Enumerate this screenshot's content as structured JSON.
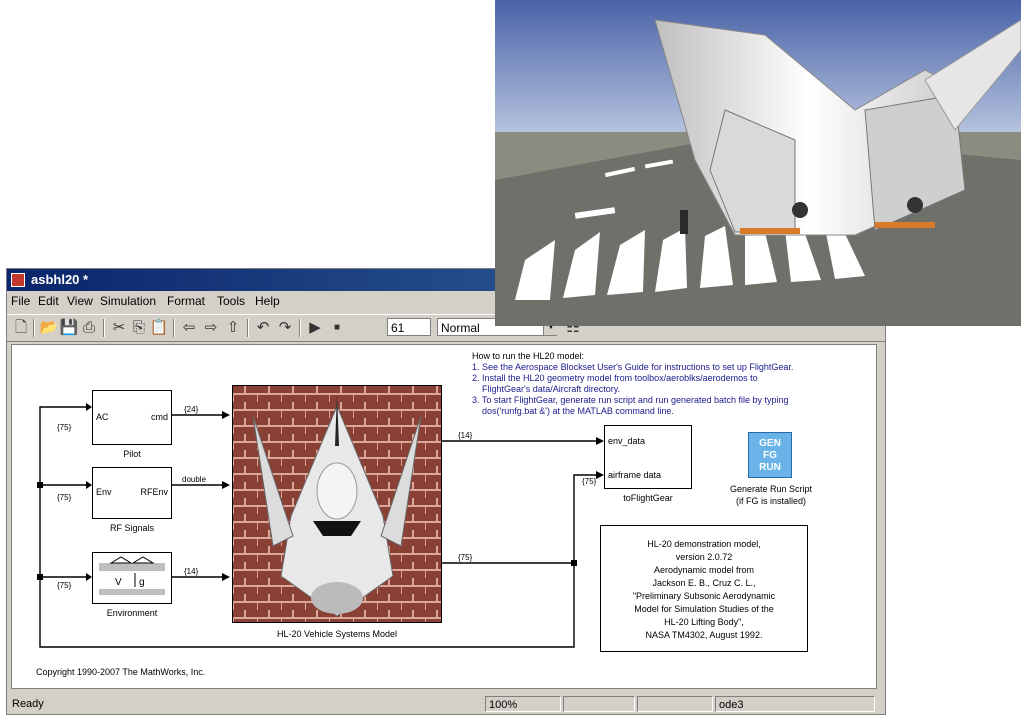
{
  "window": {
    "title": "asbhl20 *",
    "menu": [
      "File",
      "Edit",
      "View",
      "Simulation",
      "Format",
      "Tools",
      "Help"
    ],
    "stop_time": "61",
    "sim_mode": "Normal"
  },
  "blocks": {
    "pilot": {
      "label": "Pilot",
      "in_port": "AC",
      "out_port": "cmd"
    },
    "rf": {
      "label": "RF Signals",
      "in_port": "Env",
      "out_port": "RFEnv"
    },
    "env": {
      "label": "Environment"
    },
    "vehicle": {
      "label": "HL-20 Vehicle Systems Model"
    },
    "tofg": {
      "label": "toFlightGear",
      "in_port_1": "env_data",
      "in_port_2": "airframe data"
    },
    "gen": {
      "btn_l1": "GEN",
      "btn_l2": "FG",
      "btn_l3": "RUN",
      "label_l1": "Generate Run Script",
      "label_l2": "(if FG is installed)"
    }
  },
  "signals": {
    "pilot_out": "{24}",
    "rf_out": "double",
    "env_out": "{14}",
    "pilot_in": "{75}",
    "rf_in": "{75}",
    "env_in": "{75}",
    "vehicle_env": "{14}",
    "vehicle_airframe": "{75}",
    "tofg_in2": "{75}"
  },
  "howto": [
    "How to run the HL20 model:",
    "1. See the Aerospace Blockset User's Guide for instructions to set up FlightGear.",
    "2. Install the HL20 geometry model from toolbox/aeroblks/aerodemos to",
    "    FlightGear's data/Aircraft directory.",
    "3. To start FlightGear, generate run script and run generated batch file by typing",
    "    dos('runfg.bat &') at the MATLAB command line."
  ],
  "notes": [
    "HL-20 demonstration model,",
    "version 2.0.72",
    "Aerodynamic model from",
    "Jackson E. B., Cruz C. L.,",
    "\"Preliminary Subsonic Aerodynamic",
    "Model for Simulation Studies of the",
    "HL-20 Lifting Body\",",
    "NASA TM4302, August 1992."
  ],
  "copyright": "Copyright 1990-2007 The MathWorks, Inc.",
  "status": {
    "ready": "Ready",
    "zoom": "100%",
    "solver": "ode3"
  }
}
